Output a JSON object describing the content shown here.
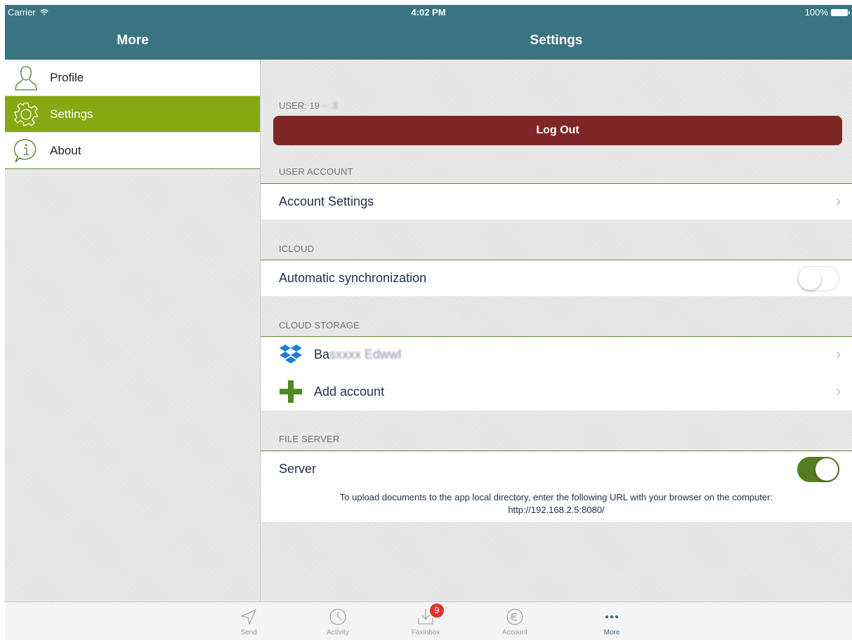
{
  "status_bar": {
    "carrier": "Carrier",
    "time": "4:02 PM",
    "battery": "100%"
  },
  "nav": {
    "left_title": "More",
    "right_title": "Settings"
  },
  "sidebar": {
    "items": [
      {
        "label": "Profile",
        "icon": "profile-icon",
        "selected": false
      },
      {
        "label": "Settings",
        "icon": "gear-icon",
        "selected": true
      },
      {
        "label": "About",
        "icon": "info-icon",
        "selected": false
      }
    ]
  },
  "settings": {
    "user_label": "USER: 19",
    "logout_label": "Log Out",
    "sections": {
      "user_account": {
        "header": "USER ACCOUNT",
        "row": "Account Settings"
      },
      "icloud": {
        "header": "ICLOUD",
        "row": "Automatic synchronization",
        "toggle_on": false
      },
      "cloud_storage": {
        "header": "CLOUD STORAGE",
        "dropbox_account": "Ba",
        "add_account": "Add account"
      },
      "file_server": {
        "header": "FILE SERVER",
        "row": "Server",
        "toggle_on": true,
        "note_line1": "To upload documents to the app local directory, enter the following URL with your browser on the computer:",
        "note_line2": "http://192.168.2.5:8080/"
      }
    }
  },
  "tabbar": {
    "tabs": [
      {
        "label": "Send",
        "icon": "send-icon"
      },
      {
        "label": "Activity",
        "icon": "clock-icon"
      },
      {
        "label": "Faxinbox",
        "icon": "inbox-download-icon",
        "badge": "9"
      },
      {
        "label": "Account",
        "icon": "euro-coin-icon"
      },
      {
        "label": "More",
        "icon": "more-dots-icon",
        "active": true
      }
    ]
  },
  "colors": {
    "nav_bar": "#3a7482",
    "sidebar_selected": "#86a812",
    "logout_button": "#7f2626",
    "toggle_on": "#547d22",
    "badge": "#e8312c"
  }
}
